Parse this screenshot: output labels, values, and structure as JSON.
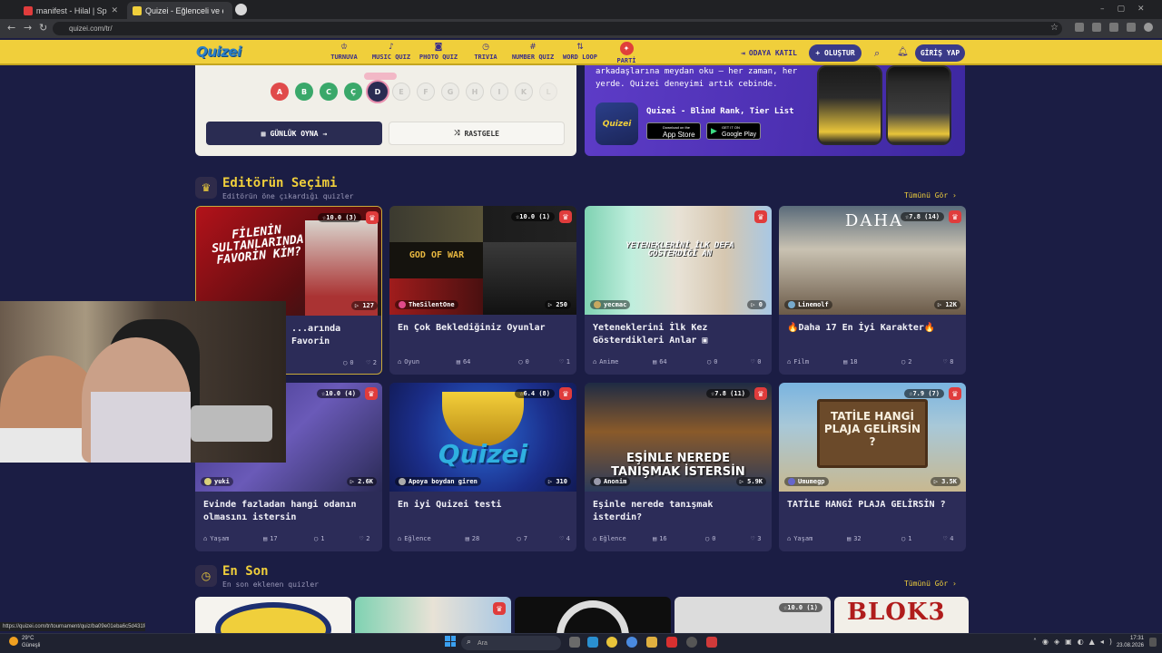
{
  "browser": {
    "tabs": [
      {
        "title": "manifest - Hilal | Special D",
        "favicon_color": "#e03c3c"
      },
      {
        "title": "Quizei - Eğlenceli ve etkileşimli",
        "favicon_color": "#f0cf3b"
      }
    ],
    "url": "quizei.com/tr/",
    "status_url": "https://quizei.com/tr/tournament/quiz/ba09e01eba6c5d431fd66692"
  },
  "header": {
    "logo": "Quizei",
    "nav": [
      {
        "label": "TURNUVA",
        "icon": "trophy-icon"
      },
      {
        "label": "MUSIC QUIZ",
        "icon": "music-icon"
      },
      {
        "label": "PHOTO QUIZ",
        "icon": "camera-icon"
      },
      {
        "label": "TRIVIA",
        "icon": "clock-icon"
      },
      {
        "label": "NUMBER QUIZ",
        "icon": "hash-icon"
      },
      {
        "label": "WORD LOOP",
        "icon": "word-icon"
      },
      {
        "label": "PARTİ",
        "icon": "party-icon"
      }
    ],
    "join_room": "ODAYA KATIL",
    "create": "+ OLUŞTUR",
    "login": "GİRİŞ YAP"
  },
  "daily": {
    "letters": [
      "A",
      "B",
      "C",
      "Ç",
      "D",
      "E",
      "F",
      "G",
      "H",
      "I",
      "İ",
      "K",
      "L"
    ],
    "selected_letter": "D",
    "daily_button": "GÜNLÜK OYNA",
    "random_button": "RASTGELE"
  },
  "promo": {
    "text_line1": "arkadaşlarına meydan oku – her zaman, her",
    "text_line2": "yerde. Quizei deneyimi artık cebinde.",
    "app_title": "Quizei - Blind Rank, Tier List",
    "app_icon_text": "Quizei",
    "appstore_small": "Download on the",
    "appstore": "App Store",
    "googleplay_small": "GET IT ON",
    "googleplay": "Google Play"
  },
  "editors_pick": {
    "title": "Editörün Seçimi",
    "subtitle": "Editörün öne çıkardığı quizler",
    "see_all": "Tümünü Gör",
    "cards": [
      {
        "rating": "10.0",
        "count": "(3)",
        "thumb_text": "FİLENİN SULTANLARINDA FAVORİN KİM?",
        "author": "Kil...",
        "plays": "127",
        "title": "...arında Favorin",
        "category": "",
        "questions": "",
        "comments": "0",
        "likes": "2"
      },
      {
        "rating": "10.0",
        "count": "(1)",
        "thumb_text": "GOD OF WAR",
        "author": "TheSilentOne",
        "plays": "250",
        "title": "En Çok Beklediğiniz Oyunlar",
        "category": "Oyun",
        "questions": "64",
        "comments": "0",
        "likes": "1"
      },
      {
        "rating": "",
        "count": "",
        "thumb_text": "YETENEKLERİNİ İLK DEFA GÖSTERDİĞİ AN",
        "author": "yecmac",
        "plays": "0",
        "title": "Yeteneklerini İlk Kez Gösterdikleri Anlar ▣",
        "category": "Anime",
        "questions": "64",
        "comments": "0",
        "likes": "0"
      },
      {
        "rating": "7.8",
        "count": "(14)",
        "thumb_text": "DAHA",
        "author": "Linemolf",
        "plays": "12K",
        "title": "🔥Daha 17 En İyi Karakter🔥",
        "category": "Film",
        "questions": "18",
        "comments": "2",
        "likes": "8"
      },
      {
        "rating": "10.0",
        "count": "(4)",
        "thumb_text": "",
        "author": "yuki",
        "plays": "2.6K",
        "title": "Evinde fazladan hangi odanın olmasını istersin",
        "category": "Yaşam",
        "questions": "17",
        "comments": "1",
        "likes": "2"
      },
      {
        "rating": "6.4",
        "count": "(8)",
        "thumb_text": "Quizei",
        "author": "Apoya boydan giren",
        "plays": "310",
        "title": "En iyi Quizei testi",
        "category": "Eğlence",
        "questions": "28",
        "comments": "7",
        "likes": "4"
      },
      {
        "rating": "7.8",
        "count": "(11)",
        "thumb_text": "EŞİNLE NEREDE TANIŞMAK İSTERSİN",
        "author": "Anonim",
        "plays": "5.9K",
        "title": "Eşinle nerede tanışmak isterdin?",
        "category": "Eğlence",
        "questions": "16",
        "comments": "0",
        "likes": "3"
      },
      {
        "rating": "7.9",
        "count": "(7)",
        "thumb_text": "TATİLE HANGİ PLAJA GELİRSİN ?",
        "author": "Umumegp",
        "plays": "3.5K",
        "title": "TATİLE HANGİ PLAJA GELİRSİN ?",
        "category": "Yaşam",
        "questions": "32",
        "comments": "1",
        "likes": "4"
      }
    ]
  },
  "latest": {
    "title": "En Son",
    "subtitle": "En son eklenen quizler",
    "see_all": "Tümünü Gör",
    "rating4": "10.0",
    "count4": "(1)",
    "thumb5": "BLOK3"
  },
  "taskbar": {
    "weather_temp": "29°C",
    "weather_desc": "Güneşli",
    "search": "Ara",
    "time": "17:31",
    "date": "23.08.2026"
  },
  "colors": {
    "accent": "#f0cf3b",
    "page_bg": "#1b1d44",
    "card_bg": "#2c2c58",
    "fav": "#e03c3c"
  }
}
